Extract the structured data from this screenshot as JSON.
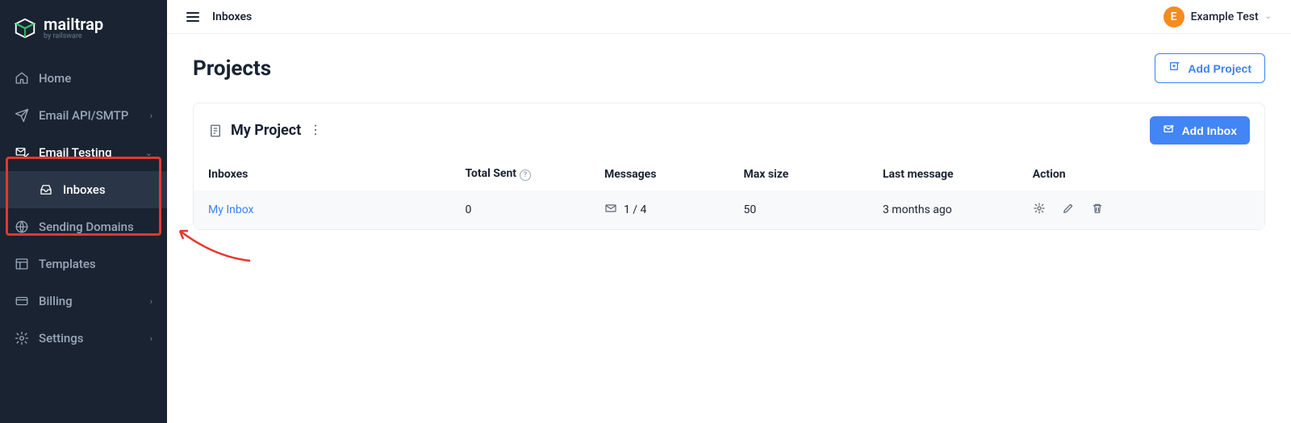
{
  "brand": {
    "name": "mailtrap",
    "byline": "by railsware"
  },
  "sidebar": {
    "items": [
      {
        "label": "Home"
      },
      {
        "label": "Email API/SMTP"
      },
      {
        "label": "Email Testing"
      },
      {
        "label": "Inboxes"
      },
      {
        "label": "Sending Domains"
      },
      {
        "label": "Templates"
      },
      {
        "label": "Billing"
      },
      {
        "label": "Settings"
      }
    ]
  },
  "topbar": {
    "breadcrumb": "Inboxes",
    "user": {
      "initial": "E",
      "name": "Example Test"
    }
  },
  "page": {
    "title": "Projects",
    "add_project_label": "Add Project"
  },
  "project": {
    "name": "My Project",
    "add_inbox_label": "Add Inbox",
    "columns": {
      "inboxes": "Inboxes",
      "total_sent": "Total Sent",
      "messages": "Messages",
      "max_size": "Max size",
      "last_message": "Last message",
      "action": "Action"
    },
    "row": {
      "name": "My Inbox",
      "total_sent": "0",
      "messages": "1 / 4",
      "max_size": "50",
      "last_message": "3 months ago"
    }
  }
}
